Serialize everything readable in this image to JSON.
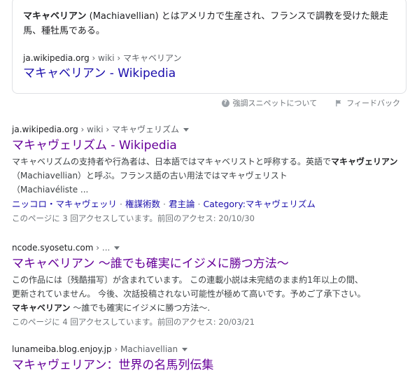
{
  "featured": {
    "snippet_bold": "マキャベリアン",
    "snippet_rest": " (Machiavellian) とはアメリカで生産され、フランスで調教を受けた競走馬、種牡馬である。",
    "cite_domain": "ja.wikipedia.org",
    "cite_path": " › wiki › マキャベリアン",
    "title": "マキャベリアン - Wikipedia",
    "help_label": "強調スニペットについて",
    "feedback_label": "フィードバック"
  },
  "results": [
    {
      "cite_domain": "ja.wikipedia.org",
      "cite_path": " › wiki › マキャヴェリズム",
      "title": "マキャヴェリズム - Wikipedia",
      "desc_1": "マキャベリズムの支持者や行為者は、日本語ではマキャベリストと呼称する。英語で",
      "desc_1_bold": "マキャヴェリアン",
      "desc_2": "（Machiavellian）と呼ぶ。フランス語の古い用法ではマキャヴェリスト",
      "desc_3": "（Machiavéliste ...",
      "sitelinks": [
        "ニッコロ・マキャヴェッリ",
        "権謀術数",
        "君主論",
        "Category:マキャヴェリズム"
      ],
      "visit_info": "このページに 3 回アクセスしています。前回のアクセス: 20/10/30"
    },
    {
      "cite_domain": "ncode.syosetu.com",
      "cite_path": " › ...",
      "title": "マキャベリアン ～誰でも確実にイジメに勝つ方法～",
      "desc_1": "この作品には〔残酷描写〕が含まれています。 この連載小説は未完結のまま約1年以上の間、",
      "desc_2": "更新されていません。 今後、次話投稿されない可能性が極めて高いです。予めご了承下さい。",
      "desc_3_bold": "マキャベリアン",
      "desc_3": " ～誰でも確実にイジメに勝つ方法～.",
      "visit_info": "このページに 4 回アクセスしています。前回のアクセス: 20/03/21"
    },
    {
      "cite_domain": "lunameiba.blog.enjoy.jp",
      "cite_path": " › Machiavellian",
      "title": "マキャヴェリアン：世界の名馬列伝集"
    }
  ]
}
